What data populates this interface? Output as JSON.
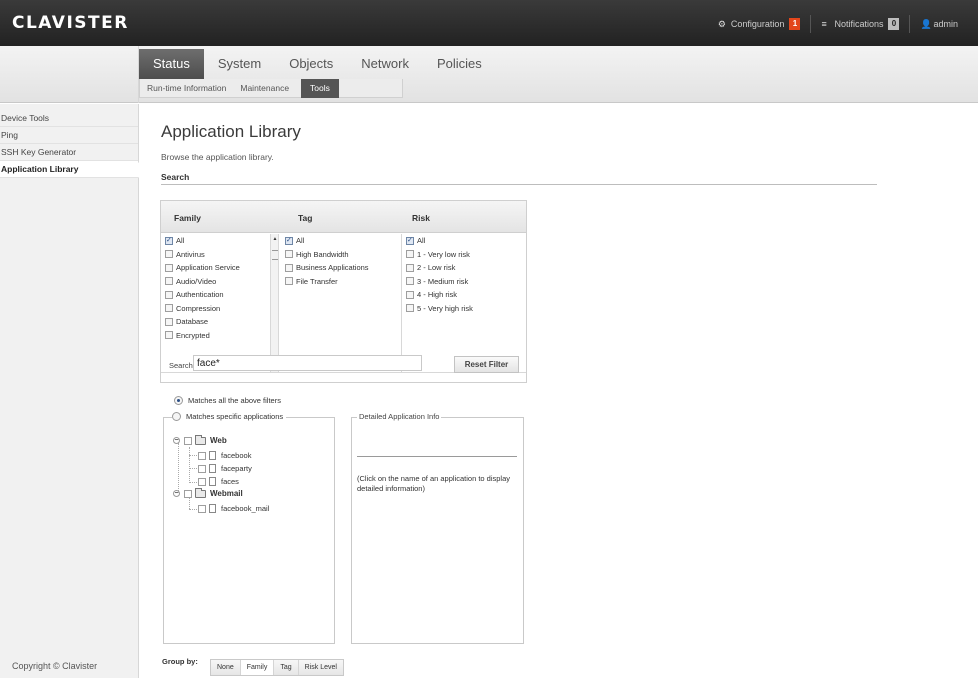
{
  "header": {
    "logo": "CLAVISTER",
    "configuration_label": "Configuration",
    "configuration_badge": "1",
    "notifications_label": "Notifications",
    "notifications_badge": "0",
    "user_label": "admin"
  },
  "main_tabs": [
    "Status",
    "System",
    "Objects",
    "Network",
    "Policies"
  ],
  "active_main_tab": "Status",
  "sub_tabs": [
    "Run-time Information",
    "Maintenance",
    "Tools"
  ],
  "active_sub_tab": "Tools",
  "sidebar": {
    "items": [
      "Device Tools",
      "Ping",
      "SSH Key Generator",
      "Application Library"
    ],
    "active": "Application Library",
    "copyright": "Copyright © Clavister"
  },
  "page": {
    "title": "Application Library",
    "description": "Browse the application library.",
    "section_search": "Search"
  },
  "filters": {
    "family_header": "Family",
    "tag_header": "Tag",
    "risk_header": "Risk",
    "family": [
      {
        "label": "All",
        "checked": true
      },
      {
        "label": "Antivirus",
        "checked": false
      },
      {
        "label": "Application Service",
        "checked": false
      },
      {
        "label": "Audio/Video",
        "checked": false
      },
      {
        "label": "Authentication",
        "checked": false
      },
      {
        "label": "Compression",
        "checked": false
      },
      {
        "label": "Database",
        "checked": false
      },
      {
        "label": "Encrypted",
        "checked": false
      }
    ],
    "tag": [
      {
        "label": "All",
        "checked": true
      },
      {
        "label": "High Bandwidth",
        "checked": false
      },
      {
        "label": "Business Applications",
        "checked": false
      },
      {
        "label": "File Transfer",
        "checked": false
      }
    ],
    "risk": [
      {
        "label": "All",
        "checked": true
      },
      {
        "label": "1 - Very low risk",
        "checked": false
      },
      {
        "label": "2 - Low risk",
        "checked": false
      },
      {
        "label": "3 - Medium risk",
        "checked": false
      },
      {
        "label": "4 - High risk",
        "checked": false
      },
      {
        "label": "5 - Very high risk",
        "checked": false
      }
    ],
    "search_label": "Search:",
    "search_value": "face*",
    "reset_label": "Reset Filter"
  },
  "match": {
    "all_label": "Matches all the above filters",
    "specific_label": "Matches specific applications",
    "selected": "all"
  },
  "tree": {
    "groups": [
      {
        "name": "Web",
        "apps": [
          "facebook",
          "faceparty",
          "faces"
        ]
      },
      {
        "name": "Webmail",
        "apps": [
          "facebook_mail"
        ]
      }
    ]
  },
  "detail": {
    "legend": "Detailed Application Info",
    "hint": "(Click on the name of an application to display detailed information)"
  },
  "group_by": {
    "label": "Group by:",
    "options": [
      "None",
      "Family",
      "Tag",
      "Risk Level"
    ],
    "active": "Family"
  }
}
